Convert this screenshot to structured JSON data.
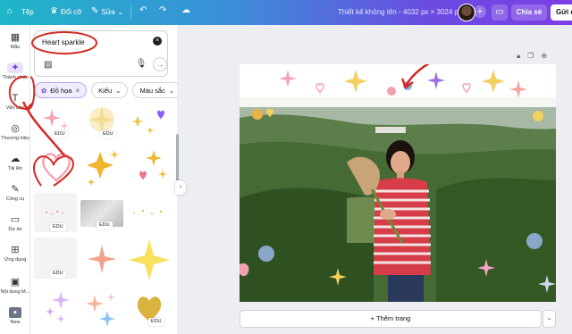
{
  "topbar": {
    "home_icon": "home-icon",
    "file_label": "Tệp",
    "resize_label": "Đổi cỡ",
    "edit_label": "Sửa",
    "undo_icon": "undo-icon",
    "redo_icon": "redo-icon",
    "cloud_icon": "cloud-save-icon",
    "doc_title": "Thiết kế không tên - 4032 px × 3024 px",
    "plus": "+",
    "share_label": "Chia sẻ",
    "send_label": "Gửi đ"
  },
  "rail": {
    "items": [
      {
        "label": "Mẫu",
        "icon": "template-icon"
      },
      {
        "label": "Thành phần",
        "icon": "elements-icon"
      },
      {
        "label": "Văn bản",
        "icon": "text-icon"
      },
      {
        "label": "Thương hiệu",
        "icon": "brand-icon"
      },
      {
        "label": "Tải lên",
        "icon": "upload-icon"
      },
      {
        "label": "Công cụ",
        "icon": "tools-icon"
      },
      {
        "label": "Dự án",
        "icon": "projects-icon"
      },
      {
        "label": "Ứng dụng",
        "icon": "apps-icon"
      },
      {
        "label": "Nội dung M...",
        "icon": "media-icon"
      },
      {
        "label": "New",
        "icon": "new-icon"
      }
    ]
  },
  "panel": {
    "search_value": "Heart sparkle",
    "filters": [
      {
        "label": "Đồ họa",
        "selected": true
      },
      {
        "label": "Kiểu",
        "selected": false
      },
      {
        "label": "Màu sắc",
        "selected": false
      }
    ],
    "edu_badge": "EDU"
  },
  "canvas": {
    "add_page_label": "+ Thêm trang"
  },
  "colors": {
    "accent": "#7c3ee6",
    "teal": "#1fb6c7",
    "annotation_red": "#d42a24"
  }
}
